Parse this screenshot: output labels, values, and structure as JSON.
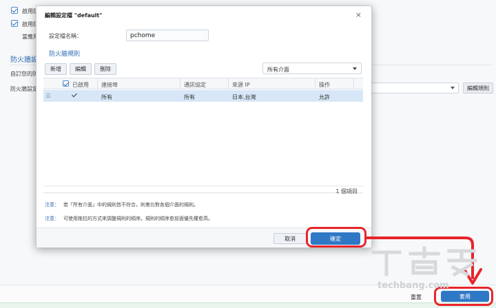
{
  "background": {
    "checkbox_rows": [
      {
        "label": "啟用防"
      },
      {
        "label": "啟用防"
      }
    ],
    "sub_label": "當應用",
    "section_title": "防火牆設定",
    "custom_text": "自訂您的防",
    "profile_label": "防火牆設定",
    "edit_rules_button": "編輯規則",
    "reset_button": "重置",
    "apply_button": "套用"
  },
  "dialog": {
    "title": "編輯設定檔 \"default\"",
    "close_glyph": "×",
    "profile_name_label": "設定檔名稱：",
    "profile_name_value": "pchome",
    "rules_section": "防火牆規則",
    "toolbar": {
      "create": "新增",
      "edit": "編輯",
      "delete": "刪除"
    },
    "interface_select": "所有介面",
    "columns": [
      "已啟用",
      "連接埠",
      "通訊協定",
      "來源 IP",
      "操作"
    ],
    "rows": [
      {
        "enabled": true,
        "port": "所有",
        "protocol": "所有",
        "source_ip": "日本,台灣",
        "action": "允許"
      }
    ],
    "item_count": "1 個項目",
    "notes": [
      {
        "label": "注意：",
        "text": "若「所有介面」中的規則皆不符合，則會比對各個介面的規則。"
      },
      {
        "label": "注意：",
        "text": "可使用拖拉的方式來調整規則的順序。規則的順序愈前面優先權愈高。"
      }
    ],
    "cancel_button": "取消",
    "ok_button": "確定"
  },
  "watermark": {
    "brand": "techbang.com"
  },
  "colors": {
    "accent_blue": "#2f78c6",
    "annotation_red": "#e8242a",
    "selected_row": "#d7e7f7"
  }
}
